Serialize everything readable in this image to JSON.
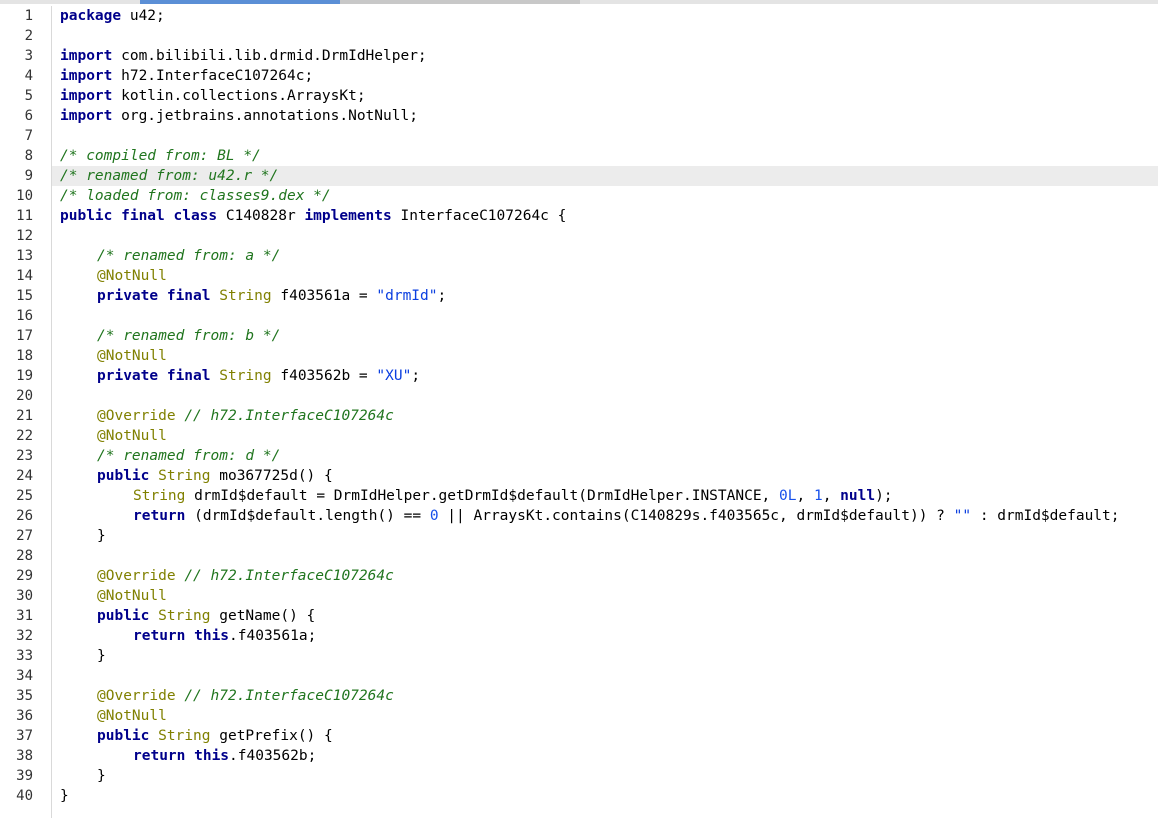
{
  "editor": {
    "line_numbers": [
      "1",
      "2",
      "3",
      "4",
      "5",
      "6",
      "7",
      "8",
      "9",
      "10",
      "11",
      "12",
      "13",
      "14",
      "15",
      "16",
      "17",
      "18",
      "19",
      "20",
      "21",
      "22",
      "23",
      "24",
      "25",
      "26",
      "27",
      "28",
      "29",
      "30",
      "31",
      "32",
      "33",
      "34",
      "35",
      "36",
      "37",
      "38",
      "39",
      "40"
    ],
    "lines": [
      {
        "indent": 0,
        "tokens": [
          {
            "t": "package",
            "k": "kw"
          },
          {
            "t": " u42;",
            "k": "pl"
          }
        ]
      },
      {
        "indent": 0,
        "tokens": []
      },
      {
        "indent": 0,
        "tokens": [
          {
            "t": "import",
            "k": "kw"
          },
          {
            "t": " com.bilibili.lib.drmid.DrmIdHelper;",
            "k": "pl"
          }
        ]
      },
      {
        "indent": 0,
        "tokens": [
          {
            "t": "import",
            "k": "kw"
          },
          {
            "t": " h72.InterfaceC107264c;",
            "k": "pl"
          }
        ]
      },
      {
        "indent": 0,
        "tokens": [
          {
            "t": "import",
            "k": "kw"
          },
          {
            "t": " kotlin.collections.ArraysKt;",
            "k": "pl"
          }
        ]
      },
      {
        "indent": 0,
        "tokens": [
          {
            "t": "import",
            "k": "kw"
          },
          {
            "t": " org.jetbrains.annotations.NotNull;",
            "k": "pl"
          }
        ]
      },
      {
        "indent": 0,
        "tokens": []
      },
      {
        "indent": 0,
        "tokens": [
          {
            "t": "/* compiled from: BL */",
            "k": "cm"
          }
        ]
      },
      {
        "indent": 0,
        "highlight": true,
        "tokens": [
          {
            "t": "/* renamed from: u42.r */",
            "k": "cm"
          }
        ]
      },
      {
        "indent": 0,
        "tokens": [
          {
            "t": "/* loaded from: classes9.dex */",
            "k": "cm"
          }
        ]
      },
      {
        "indent": 0,
        "tokens": [
          {
            "t": "public final class",
            "k": "kw"
          },
          {
            "t": " C140828r ",
            "k": "pl"
          },
          {
            "t": "implements",
            "k": "kw"
          },
          {
            "t": " InterfaceC107264c {",
            "k": "pl"
          }
        ]
      },
      {
        "indent": 0,
        "tokens": []
      },
      {
        "indent": 1,
        "tokens": [
          {
            "t": "/* renamed from: a */",
            "k": "cm"
          }
        ]
      },
      {
        "indent": 1,
        "tokens": [
          {
            "t": "@NotNull",
            "k": "an"
          }
        ]
      },
      {
        "indent": 1,
        "tokens": [
          {
            "t": "private final",
            "k": "kw"
          },
          {
            "t": " ",
            "k": "pl"
          },
          {
            "t": "String",
            "k": "ty"
          },
          {
            "t": " f403561a = ",
            "k": "pl"
          },
          {
            "t": "\"drmId\"",
            "k": "st"
          },
          {
            "t": ";",
            "k": "pl"
          }
        ]
      },
      {
        "indent": 0,
        "tokens": []
      },
      {
        "indent": 1,
        "tokens": [
          {
            "t": "/* renamed from: b */",
            "k": "cm"
          }
        ]
      },
      {
        "indent": 1,
        "tokens": [
          {
            "t": "@NotNull",
            "k": "an"
          }
        ]
      },
      {
        "indent": 1,
        "tokens": [
          {
            "t": "private final",
            "k": "kw"
          },
          {
            "t": " ",
            "k": "pl"
          },
          {
            "t": "String",
            "k": "ty"
          },
          {
            "t": " f403562b = ",
            "k": "pl"
          },
          {
            "t": "\"XU\"",
            "k": "st"
          },
          {
            "t": ";",
            "k": "pl"
          }
        ]
      },
      {
        "indent": 0,
        "tokens": []
      },
      {
        "indent": 1,
        "tokens": [
          {
            "t": "@Override",
            "k": "an"
          },
          {
            "t": " ",
            "k": "pl"
          },
          {
            "t": "// h72.InterfaceC107264c",
            "k": "cm"
          }
        ]
      },
      {
        "indent": 1,
        "tokens": [
          {
            "t": "@NotNull",
            "k": "an"
          }
        ]
      },
      {
        "indent": 1,
        "tokens": [
          {
            "t": "/* renamed from: d */",
            "k": "cm"
          }
        ]
      },
      {
        "indent": 1,
        "tokens": [
          {
            "t": "public",
            "k": "kw"
          },
          {
            "t": " ",
            "k": "pl"
          },
          {
            "t": "String",
            "k": "ty"
          },
          {
            "t": " mo367725d() {",
            "k": "pl"
          }
        ]
      },
      {
        "indent": 2,
        "tokens": [
          {
            "t": "String",
            "k": "ty"
          },
          {
            "t": " drmId$default = DrmIdHelper.getDrmId$default(DrmIdHelper.INSTANCE, ",
            "k": "pl"
          },
          {
            "t": "0L",
            "k": "nu"
          },
          {
            "t": ", ",
            "k": "pl"
          },
          {
            "t": "1",
            "k": "nu"
          },
          {
            "t": ", ",
            "k": "pl"
          },
          {
            "t": "null",
            "k": "kw"
          },
          {
            "t": ");",
            "k": "pl"
          }
        ]
      },
      {
        "indent": 2,
        "tokens": [
          {
            "t": "return",
            "k": "kw"
          },
          {
            "t": " (drmId$default.length() == ",
            "k": "pl"
          },
          {
            "t": "0",
            "k": "nu"
          },
          {
            "t": " || ArraysKt.contains(C140829s.f403565c, drmId$default)) ? ",
            "k": "pl"
          },
          {
            "t": "\"\"",
            "k": "st"
          },
          {
            "t": " : drmId$default;",
            "k": "pl"
          }
        ]
      },
      {
        "indent": 1,
        "tokens": [
          {
            "t": "}",
            "k": "pl"
          }
        ]
      },
      {
        "indent": 0,
        "tokens": []
      },
      {
        "indent": 1,
        "tokens": [
          {
            "t": "@Override",
            "k": "an"
          },
          {
            "t": " ",
            "k": "pl"
          },
          {
            "t": "// h72.InterfaceC107264c",
            "k": "cm"
          }
        ]
      },
      {
        "indent": 1,
        "tokens": [
          {
            "t": "@NotNull",
            "k": "an"
          }
        ]
      },
      {
        "indent": 1,
        "tokens": [
          {
            "t": "public",
            "k": "kw"
          },
          {
            "t": " ",
            "k": "pl"
          },
          {
            "t": "String",
            "k": "ty"
          },
          {
            "t": " getName() {",
            "k": "pl"
          }
        ]
      },
      {
        "indent": 2,
        "tokens": [
          {
            "t": "return this",
            "k": "kw"
          },
          {
            "t": ".f403561a;",
            "k": "pl"
          }
        ]
      },
      {
        "indent": 1,
        "tokens": [
          {
            "t": "}",
            "k": "pl"
          }
        ]
      },
      {
        "indent": 0,
        "tokens": []
      },
      {
        "indent": 1,
        "tokens": [
          {
            "t": "@Override",
            "k": "an"
          },
          {
            "t": " ",
            "k": "pl"
          },
          {
            "t": "// h72.InterfaceC107264c",
            "k": "cm"
          }
        ]
      },
      {
        "indent": 1,
        "tokens": [
          {
            "t": "@NotNull",
            "k": "an"
          }
        ]
      },
      {
        "indent": 1,
        "tokens": [
          {
            "t": "public",
            "k": "kw"
          },
          {
            "t": " ",
            "k": "pl"
          },
          {
            "t": "String",
            "k": "ty"
          },
          {
            "t": " getPrefix() {",
            "k": "pl"
          }
        ]
      },
      {
        "indent": 2,
        "tokens": [
          {
            "t": "return this",
            "k": "kw"
          },
          {
            "t": ".f403562b;",
            "k": "pl"
          }
        ]
      },
      {
        "indent": 1,
        "tokens": [
          {
            "t": "}",
            "k": "pl"
          }
        ]
      },
      {
        "indent": 0,
        "tokens": [
          {
            "t": "}",
            "k": "pl"
          }
        ]
      }
    ]
  },
  "colors": {
    "keyword": "#00008b",
    "type": "#808000",
    "annotation": "#808000",
    "comment": "#20751e",
    "string": "#0a3ee0",
    "number": "#1750eb",
    "highlight_line": "#ececec",
    "tab_active": "#5b8fd6"
  }
}
